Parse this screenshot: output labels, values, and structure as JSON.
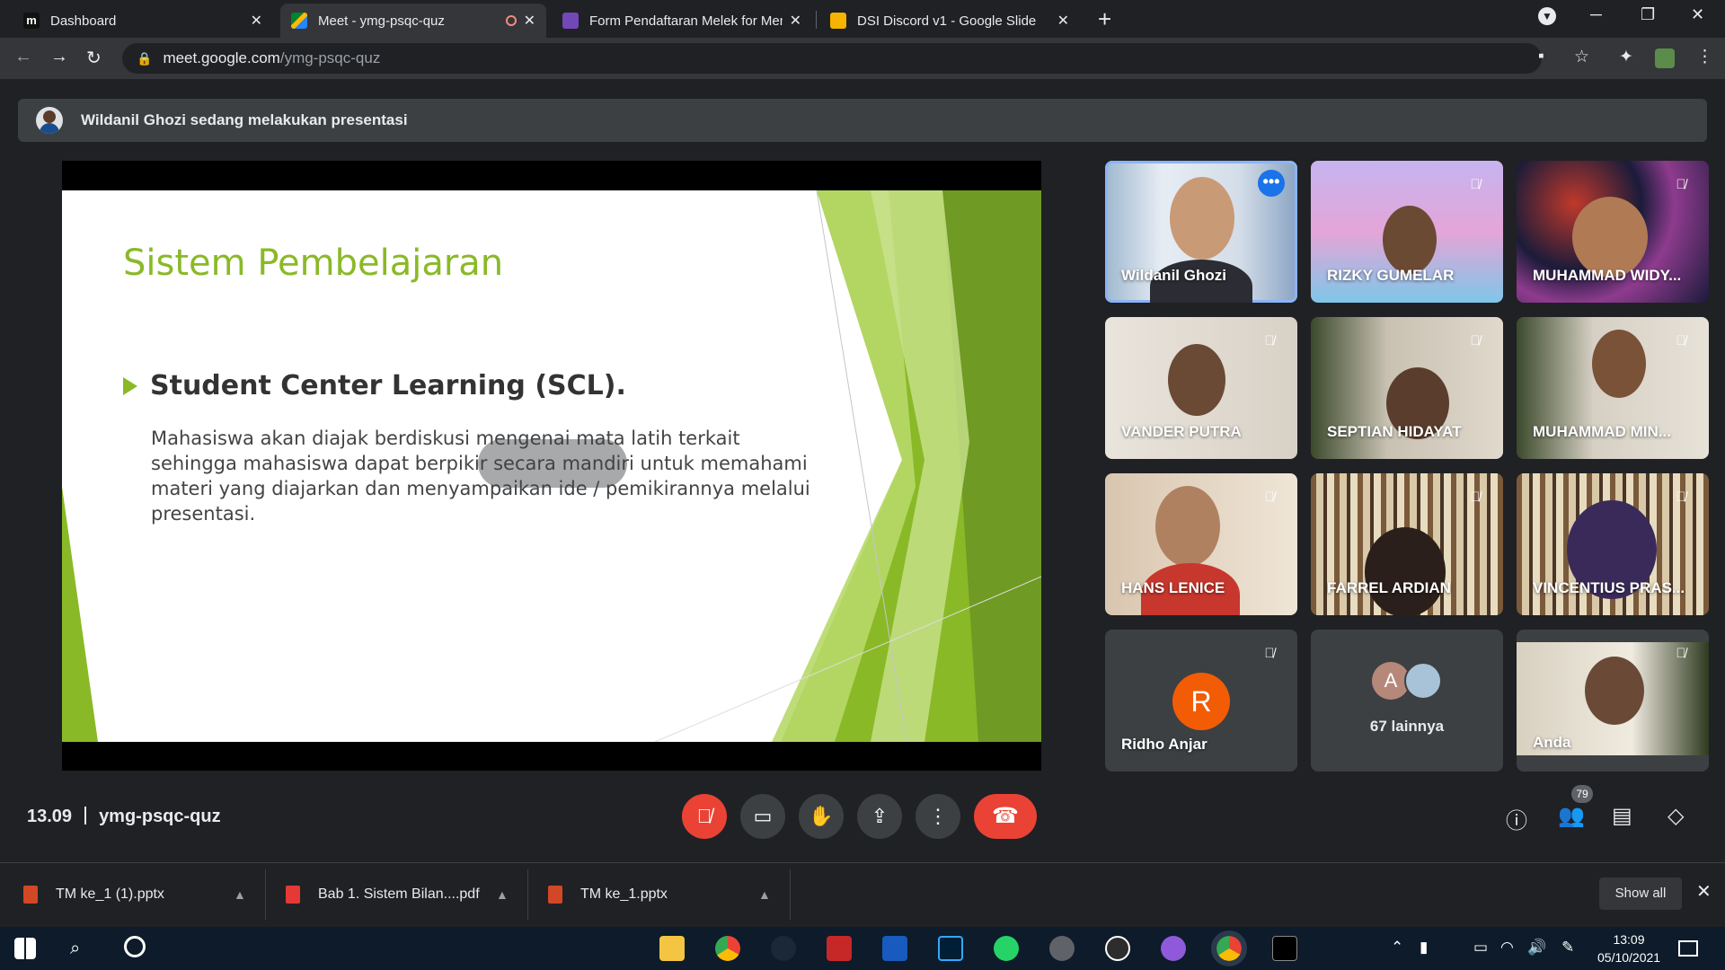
{
  "tabs": [
    {
      "title": "Dashboard",
      "icon": "moodle-icon"
    },
    {
      "title": "Meet - ymg-psqc-quz",
      "icon": "meet-icon",
      "active": true
    },
    {
      "title": "Form Pendaftaran Melek for Mem",
      "icon": "forms-icon"
    },
    {
      "title": "DSI Discord v1 - Google Slide",
      "icon": "slides-icon"
    }
  ],
  "url": {
    "host": "meet.google.com",
    "path": "/ymg-psqc-quz"
  },
  "banner": {
    "text": "Wildanil Ghozi sedang melakukan presentasi"
  },
  "slide": {
    "title": "Sistem Pembelajaran",
    "bullet": "Student Center Learning (SCL).",
    "body": "Mahasiswa akan diajak berdiskusi mengenai mata latih terkait sehingga mahasiswa dapat berpikir secara mandiri untuk memahami materi yang diajarkan dan menyampaikan ide / pemikirannya melalui presentasi."
  },
  "participants": [
    {
      "name": "Wildanil Ghozi",
      "state": "speaking"
    },
    {
      "name": "RIZKY GUMELAR",
      "state": "muted"
    },
    {
      "name": "MUHAMMAD WIDY...",
      "state": "muted"
    },
    {
      "name": "VANDER PUTRA",
      "state": "muted"
    },
    {
      "name": "SEPTIAN HIDAYAT",
      "state": "muted"
    },
    {
      "name": "MUHAMMAD MIN...",
      "state": "muted"
    },
    {
      "name": "HANS LENICE",
      "state": "muted"
    },
    {
      "name": "FARREL ARDIAN",
      "state": "muted"
    },
    {
      "name": "VINCENTIUS PRAS...",
      "state": "muted"
    },
    {
      "name": "Ridho Anjar",
      "state": "muted",
      "avatar_letter": "R"
    },
    {
      "name": "67 lainnya",
      "avatar_letter": "A"
    },
    {
      "name": "Anda",
      "state": "muted"
    }
  ],
  "meeting": {
    "time": "13.09",
    "code": "ymg-psqc-quz",
    "people_count": "79"
  },
  "downloads": [
    {
      "name": "TM ke_1 (1).pptx"
    },
    {
      "name": "Bab 1. Sistem Bilan....pdf"
    },
    {
      "name": "TM ke_1.pptx"
    }
  ],
  "downloads_show_all": "Show all",
  "taskbar": {
    "time": "13:09",
    "date": "05/10/2021"
  }
}
